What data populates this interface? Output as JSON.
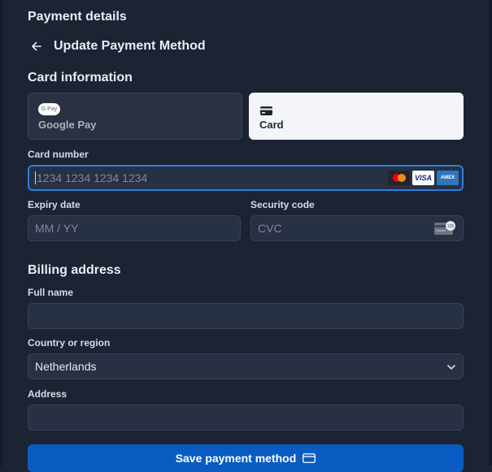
{
  "header": {
    "section_title": "Payment details",
    "page_title": "Update Payment Method"
  },
  "card_information": {
    "heading": "Card information",
    "tabs": [
      {
        "label": "Google Pay",
        "badge": "G Pay",
        "selected": false
      },
      {
        "label": "Card",
        "selected": true
      }
    ]
  },
  "card_number": {
    "label": "Card number",
    "placeholder": "1234 1234 1234 1234",
    "value": "",
    "brands": [
      "Mastercard",
      "VISA",
      "AMEX"
    ]
  },
  "expiry": {
    "label": "Expiry date",
    "placeholder": "MM / YY",
    "value": ""
  },
  "security_code": {
    "label": "Security code",
    "placeholder": "CVC",
    "value": "",
    "hint_badge": "135"
  },
  "billing_address": {
    "heading": "Billing address",
    "full_name": {
      "label": "Full name",
      "value": ""
    },
    "country": {
      "label": "Country or region",
      "value": "Netherlands"
    },
    "address": {
      "label": "Address",
      "value": ""
    }
  },
  "actions": {
    "save_label": "Save payment method"
  },
  "colors": {
    "background": "#1c2333",
    "field": "#283044",
    "focus_border": "#2d7fe0",
    "primary_button": "#0a5cc2",
    "selected_tab": "#f3f5f9"
  }
}
